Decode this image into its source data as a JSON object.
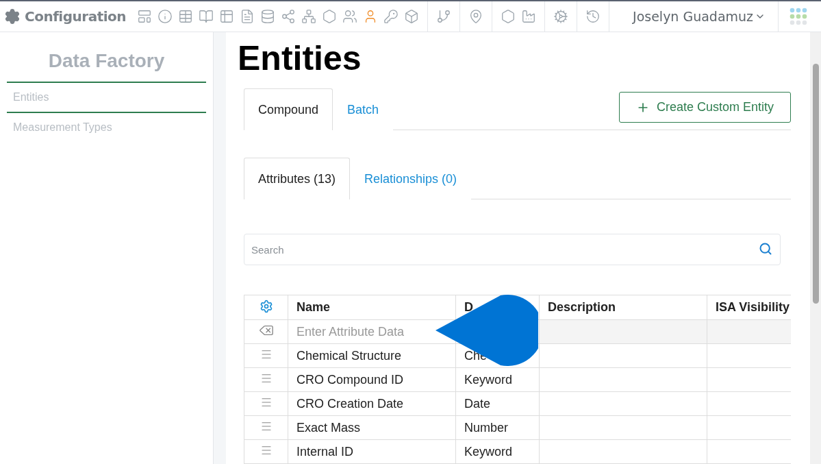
{
  "header": {
    "title": "Configuration",
    "user": "Joselyn Guadamuz"
  },
  "toolbar_icons": [
    {
      "selected": false
    },
    {
      "selected": false
    },
    {
      "selected": false
    },
    {
      "selected": false
    },
    {
      "selected": false
    },
    {
      "selected": false
    },
    {
      "selected": false
    },
    {
      "selected": false
    },
    {
      "selected": false
    },
    {
      "selected": false
    },
    {
      "selected": false
    },
    {
      "selected": true
    },
    {
      "selected": false
    },
    {
      "selected": false
    },
    {
      "selected": false
    },
    {
      "selected": false
    },
    {
      "selected": false
    },
    {
      "selected": false
    },
    {
      "selected": false
    },
    {
      "selected": false
    }
  ],
  "sidebar": {
    "title": "Data Factory",
    "items": [
      {
        "label": "Entities",
        "selected": true
      },
      {
        "label": "Measurement Types",
        "selected": false
      }
    ]
  },
  "page_title": "Entities",
  "entity_tabs": [
    {
      "label": "Compound",
      "selected": true
    },
    {
      "label": "Batch",
      "selected": false
    }
  ],
  "create_button": "Create Custom Entity",
  "attribute_tabs": [
    {
      "label": "Attributes (13)",
      "selected": true
    },
    {
      "label": "Relationships (0)",
      "selected": false
    }
  ],
  "search": {
    "placeholder": "Search"
  },
  "table": {
    "columns": [
      "Name",
      "D",
      "Description",
      "ISA Visibility"
    ],
    "new_row": {
      "placeholder": "Enter Attribute Data"
    },
    "rows": [
      {
        "name": "Chemical Structure",
        "type": "Che"
      },
      {
        "name": "CRO Compound ID",
        "type": "Keyword"
      },
      {
        "name": "CRO Creation Date",
        "type": "Date"
      },
      {
        "name": "Exact Mass",
        "type": "Number"
      },
      {
        "name": "Internal ID",
        "type": "Keyword"
      }
    ]
  }
}
